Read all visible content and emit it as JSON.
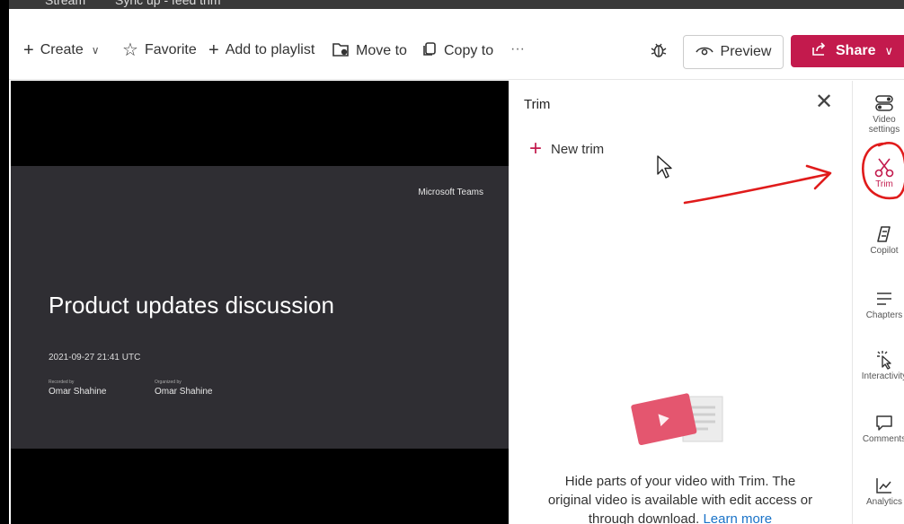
{
  "top_strip": {
    "app_name": "Stream",
    "file_name": "Sync up - feed trim"
  },
  "toolbar": {
    "create": "Create",
    "favorite": "Favorite",
    "add_to_playlist": "Add to playlist",
    "move_to": "Move to",
    "copy_to": "Copy to",
    "more": "···",
    "preview": "Preview",
    "share": "Share"
  },
  "video": {
    "brand": "Microsoft Teams",
    "title": "Product updates discussion",
    "datetime": "2021-09-27 21:41 UTC",
    "recorded_by_label": "Recorded by",
    "recorded_by": "Omar Shahine",
    "organized_by_label": "Organized by",
    "organized_by": "Omar Shahine"
  },
  "trim_panel": {
    "title": "Trim",
    "new_trim": "New trim",
    "empty_text": "Hide parts of your video with Trim. The original video is available with edit access or through download.",
    "learn_more": "Learn more"
  },
  "rail": {
    "video_settings": "Video settings",
    "trim": "Trim",
    "copilot": "Copilot",
    "chapters": "Chapters",
    "interactivity": "Interactivity",
    "comments": "Comments",
    "analytics": "Analytics"
  },
  "colors": {
    "accent": "#c31a4d",
    "annotation": "#e01b1b",
    "link": "#1a73c8"
  }
}
